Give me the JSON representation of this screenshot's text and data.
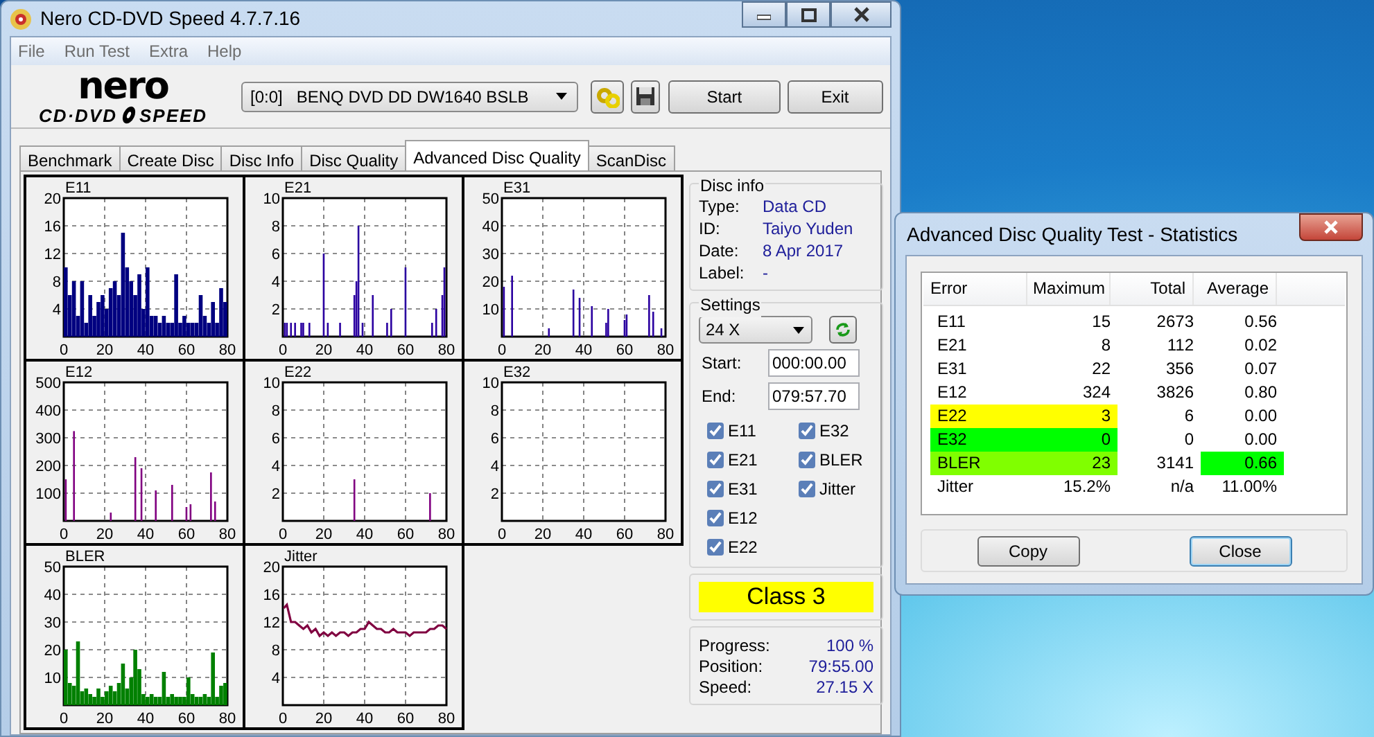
{
  "window": {
    "title": "Nero CD-DVD Speed 4.7.7.16"
  },
  "menu": [
    "File",
    "Run Test",
    "Extra",
    "Help"
  ],
  "logo": {
    "wordmark": "nero",
    "left": "CD·DVD",
    "right": "SPEED"
  },
  "drive_select": {
    "value": "[0:0]   BENQ DVD DD DW1640 BSLB"
  },
  "toolbar_buttons": [
    "Start",
    "Exit"
  ],
  "tabs": [
    {
      "label": "Benchmark",
      "selected": false
    },
    {
      "label": "Create Disc",
      "selected": false
    },
    {
      "label": "Disc Info",
      "selected": false
    },
    {
      "label": "Disc Quality",
      "selected": false
    },
    {
      "label": "Advanced Disc Quality",
      "selected": true
    },
    {
      "label": "ScanDisc",
      "selected": false
    }
  ],
  "charts": [
    {
      "chart_data": {
        "type": "bar",
        "title": "E11",
        "x": [
          0,
          2,
          4,
          6,
          8,
          10,
          12,
          14,
          16,
          18,
          20,
          22,
          24,
          26,
          28,
          30,
          32,
          34,
          36,
          38,
          40,
          42,
          44,
          46,
          48,
          50,
          52,
          54,
          56,
          58,
          60,
          62,
          64,
          66,
          68,
          70,
          72,
          74,
          76,
          78
        ],
        "grid": true,
        "series": [
          {
            "color": "#000080",
            "values": [
              10,
              6,
              8,
              3,
              8,
              2,
              6,
              3,
              5,
              6,
              4,
              7,
              8,
              6,
              15,
              10,
              8,
              6,
              9,
              4,
              10,
              3,
              3,
              2,
              3,
              2,
              2,
              9,
              2,
              3,
              2,
              2,
              2,
              6,
              3,
              2,
              5,
              2,
              7,
              5
            ]
          }
        ],
        "xlim": [
          0,
          80
        ],
        "ylim": [
          0,
          20
        ],
        "xticks": [
          0,
          20,
          40,
          60,
          80
        ],
        "yticks": [
          4,
          8,
          12,
          16,
          20
        ]
      }
    },
    {
      "chart_data": {
        "type": "bar",
        "title": "E21",
        "x": [
          0,
          1,
          3,
          5,
          8,
          9,
          12,
          19,
          21,
          27,
          34,
          35,
          36,
          38,
          43,
          50,
          52,
          59,
          72,
          74,
          77,
          78
        ],
        "grid": true,
        "series": [
          {
            "color": "#2a00a0",
            "values": [
              1,
              1,
              1,
              1,
              1,
              1,
              1,
              6,
              1,
              1,
              3,
              4,
              8,
              1,
              3,
              1,
              2,
              5,
              1,
              2,
              3,
              5
            ]
          }
        ],
        "xlim": [
          0,
          80
        ],
        "ylim": [
          0,
          10
        ],
        "xticks": [
          0,
          20,
          40,
          60,
          80
        ],
        "yticks": [
          2,
          4,
          6,
          8,
          10
        ]
      }
    },
    {
      "chart_data": {
        "type": "bar",
        "title": "E31",
        "x": [
          0,
          4,
          22,
          34,
          37,
          43,
          50,
          51,
          59,
          60,
          71,
          73,
          77
        ],
        "grid": true,
        "series": [
          {
            "color": "#2a00a0",
            "values": [
              18,
              22,
              3,
              17,
              14,
              11,
              5,
              10,
              6,
              8,
              15,
              9,
              3
            ]
          }
        ],
        "xlim": [
          0,
          80
        ],
        "ylim": [
          0,
          50
        ],
        "xticks": [
          0,
          20,
          40,
          60,
          80
        ],
        "yticks": [
          10,
          20,
          30,
          40,
          50
        ]
      }
    },
    {
      "chart_data": {
        "type": "bar",
        "title": "E12",
        "x": [
          0,
          4,
          22,
          34,
          37,
          44,
          52,
          59,
          61,
          71,
          73
        ],
        "grid": true,
        "series": [
          {
            "color": "#800080",
            "values": [
              150,
              324,
              30,
              230,
              190,
              110,
              130,
              50,
              60,
              175,
              70
            ]
          }
        ],
        "xlim": [
          0,
          80
        ],
        "ylim": [
          0,
          500
        ],
        "xticks": [
          0,
          20,
          40,
          60,
          80
        ],
        "yticks": [
          100,
          200,
          300,
          400,
          500
        ]
      }
    },
    {
      "chart_data": {
        "type": "bar",
        "title": "E22",
        "x": [
          34,
          71
        ],
        "grid": true,
        "series": [
          {
            "color": "#800080",
            "values": [
              3,
              2
            ]
          }
        ],
        "xlim": [
          0,
          80
        ],
        "ylim": [
          0,
          10
        ],
        "xticks": [
          0,
          20,
          40,
          60,
          80
        ],
        "yticks": [
          2,
          4,
          6,
          8,
          10
        ]
      }
    },
    {
      "chart_data": {
        "type": "bar",
        "title": "E32",
        "grid": true,
        "xlim": [
          0,
          80
        ],
        "ylim": [
          0,
          10
        ],
        "xticks": [
          0,
          20,
          40,
          60,
          80
        ],
        "yticks": [
          2,
          4,
          6,
          8,
          10
        ]
      }
    },
    {
      "chart_data": {
        "type": "bar",
        "title": "BLER",
        "x": [
          0,
          2,
          4,
          6,
          8,
          10,
          12,
          14,
          16,
          18,
          20,
          22,
          24,
          26,
          28,
          30,
          32,
          34,
          36,
          38,
          40,
          42,
          44,
          46,
          48,
          50,
          52,
          54,
          56,
          58,
          60,
          62,
          64,
          66,
          68,
          70,
          72,
          74,
          76,
          78
        ],
        "grid": true,
        "series": [
          {
            "color": "#008000",
            "values": [
              20,
              8,
              7,
              23,
              5,
              6,
              4,
              3,
              6,
              3,
              5,
              7,
              5,
              8,
              15,
              6,
              10,
              20,
              13,
              4,
              3,
              4,
              3,
              3,
              12,
              3,
              4,
              3,
              3,
              3,
              10,
              4,
              3,
              3,
              4,
              3,
              19,
              3,
              7,
              8
            ]
          }
        ],
        "xlim": [
          0,
          80
        ],
        "ylim": [
          0,
          50
        ],
        "xticks": [
          0,
          20,
          40,
          60,
          80
        ],
        "yticks": [
          10,
          20,
          30,
          40,
          50
        ]
      }
    },
    {
      "chart_data": {
        "type": "line",
        "title": "Jitter",
        "x": [
          0.5,
          2,
          4,
          6,
          8,
          10,
          12,
          14,
          16,
          18,
          20,
          22,
          24,
          26,
          28,
          30,
          32,
          34,
          36,
          38,
          40,
          42,
          44,
          46,
          48,
          50,
          52,
          54,
          56,
          58,
          60,
          62,
          64,
          66,
          68,
          70,
          72,
          74,
          76,
          78,
          80
        ],
        "grid": true,
        "series": [
          {
            "color": "#800040",
            "values": [
              14,
              14.5,
              12,
              12,
              11.5,
              11,
              11.5,
              10.5,
              11,
              10,
              10.5,
              10,
              10.5,
              10,
              10.5,
              10.5,
              10,
              10.5,
              10.5,
              11,
              11,
              12,
              11.5,
              11,
              11,
              10.5,
              10.5,
              11,
              10.5,
              10.5,
              10.5,
              10,
              10.5,
              10.5,
              10.5,
              10.5,
              11,
              11,
              11.5,
              11.5,
              11
            ]
          }
        ],
        "xlim": [
          0,
          80
        ],
        "ylim": [
          0,
          20
        ],
        "xticks": [
          0,
          20,
          40,
          60,
          80
        ],
        "yticks": [
          4,
          8,
          12,
          16,
          20
        ]
      }
    }
  ],
  "disc_info": {
    "title": "Disc info",
    "fields": [
      {
        "label": "Type:",
        "value": "Data CD"
      },
      {
        "label": "ID:",
        "value": "Taiyo Yuden"
      },
      {
        "label": "Date:",
        "value": "8 Apr 2017"
      },
      {
        "label": "Label:",
        "value": "-"
      }
    ]
  },
  "settings": {
    "title": "Settings",
    "speed": "24 X",
    "start_label": "Start:",
    "start_value": "000:00.00",
    "end_label": "End:",
    "end_value": "079:57.70",
    "checkboxes": [
      {
        "label": "E11",
        "checked": true
      },
      {
        "label": "E21",
        "checked": true
      },
      {
        "label": "E31",
        "checked": true
      },
      {
        "label": "E12",
        "checked": true
      },
      {
        "label": "E22",
        "checked": true
      },
      {
        "label": "E32",
        "checked": true
      },
      {
        "label": "BLER",
        "checked": true
      },
      {
        "label": "Jitter",
        "checked": true
      }
    ]
  },
  "class_result": {
    "text": "Class 3",
    "color": "#ffff00"
  },
  "progress": [
    {
      "label": "Progress:",
      "value": "100 %"
    },
    {
      "label": "Position:",
      "value": "79:55.00"
    },
    {
      "label": "Speed:",
      "value": "27.15 X"
    }
  ],
  "dialog": {
    "title": "Advanced Disc Quality Test - Statistics",
    "columns": [
      "Error",
      "Maximum",
      "Total",
      "Average"
    ],
    "rows": [
      {
        "cells": [
          {
            "text": "E11"
          },
          {
            "text": "15"
          },
          {
            "text": "2673"
          },
          {
            "text": "0.56"
          }
        ]
      },
      {
        "cells": [
          {
            "text": "E21"
          },
          {
            "text": "8"
          },
          {
            "text": "112"
          },
          {
            "text": "0.02"
          }
        ]
      },
      {
        "cells": [
          {
            "text": "E31"
          },
          {
            "text": "22"
          },
          {
            "text": "356"
          },
          {
            "text": "0.07"
          }
        ]
      },
      {
        "cells": [
          {
            "text": "E12"
          },
          {
            "text": "324"
          },
          {
            "text": "3826"
          },
          {
            "text": "0.80"
          }
        ]
      },
      {
        "cells": [
          {
            "text": "E22",
            "color": "#ffff00"
          },
          {
            "text": "3",
            "color": "#ffff00"
          },
          {
            "text": "6"
          },
          {
            "text": "0.00"
          }
        ]
      },
      {
        "cells": [
          {
            "text": "E32",
            "color": "#00ff00"
          },
          {
            "text": "0",
            "color": "#00ff00"
          },
          {
            "text": "0"
          },
          {
            "text": "0.00"
          }
        ]
      },
      {
        "cells": [
          {
            "text": "BLER",
            "color": "#80ff00"
          },
          {
            "text": "23",
            "color": "#80ff00"
          },
          {
            "text": "3141"
          },
          {
            "text": "0.66",
            "color": "#00ff00"
          }
        ]
      },
      {
        "cells": [
          {
            "text": "Jitter"
          },
          {
            "text": "15.2%"
          },
          {
            "text": "n/a"
          },
          {
            "text": "11.00%"
          }
        ]
      }
    ],
    "buttons": [
      {
        "label": "Copy",
        "selected": false
      },
      {
        "label": "Close",
        "selected": true
      }
    ]
  }
}
